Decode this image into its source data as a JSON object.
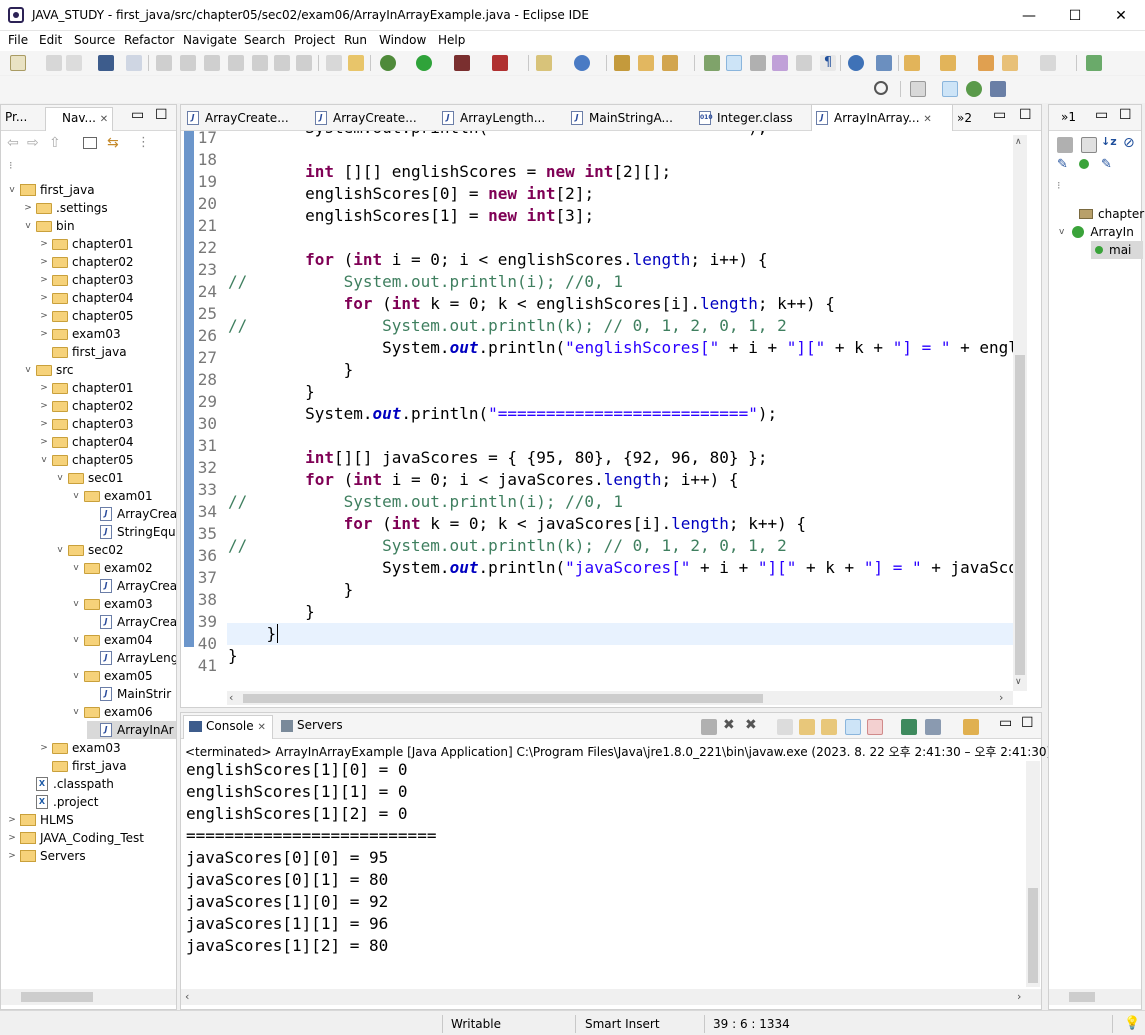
{
  "window": {
    "title": "JAVA_STUDY - first_java/src/chapter05/sec02/exam06/ArrayInArrayExample.java - Eclipse IDE",
    "minimize_glyph": "—",
    "maximize_glyph": "☐",
    "close_glyph": "✕"
  },
  "menu": [
    "File",
    "Edit",
    "Source",
    "Refactor",
    "Navigate",
    "Search",
    "Project",
    "Run",
    "Window",
    "Help"
  ],
  "left_panel": {
    "tabs": [
      "Pr...",
      "Nav..."
    ],
    "close_glyph": "✕",
    "tree": [
      {
        "depth": 0,
        "tw": "v",
        "kind": "proj",
        "label": "first_java"
      },
      {
        "depth": 1,
        "tw": ">",
        "kind": "folder",
        "label": ".settings"
      },
      {
        "depth": 1,
        "tw": "v",
        "kind": "folder",
        "label": "bin"
      },
      {
        "depth": 2,
        "tw": ">",
        "kind": "folder",
        "label": "chapter01"
      },
      {
        "depth": 2,
        "tw": ">",
        "kind": "folder",
        "label": "chapter02"
      },
      {
        "depth": 2,
        "tw": ">",
        "kind": "folder",
        "label": "chapter03"
      },
      {
        "depth": 2,
        "tw": ">",
        "kind": "folder",
        "label": "chapter04"
      },
      {
        "depth": 2,
        "tw": ">",
        "kind": "folder",
        "label": "chapter05"
      },
      {
        "depth": 2,
        "tw": ">",
        "kind": "folder",
        "label": "exam03"
      },
      {
        "depth": 2,
        "tw": "",
        "kind": "folder",
        "label": "first_java"
      },
      {
        "depth": 1,
        "tw": "v",
        "kind": "folder",
        "label": "src"
      },
      {
        "depth": 2,
        "tw": ">",
        "kind": "folder",
        "label": "chapter01"
      },
      {
        "depth": 2,
        "tw": ">",
        "kind": "folder",
        "label": "chapter02"
      },
      {
        "depth": 2,
        "tw": ">",
        "kind": "folder",
        "label": "chapter03"
      },
      {
        "depth": 2,
        "tw": ">",
        "kind": "folder",
        "label": "chapter04"
      },
      {
        "depth": 2,
        "tw": "v",
        "kind": "folder",
        "label": "chapter05"
      },
      {
        "depth": 3,
        "tw": "v",
        "kind": "folder",
        "label": "sec01"
      },
      {
        "depth": 4,
        "tw": "v",
        "kind": "folder",
        "label": "exam01"
      },
      {
        "depth": 5,
        "tw": "",
        "kind": "java",
        "label": "ArrayCrea"
      },
      {
        "depth": 5,
        "tw": "",
        "kind": "java",
        "label": "StringEqu"
      },
      {
        "depth": 3,
        "tw": "v",
        "kind": "folder",
        "label": "sec02"
      },
      {
        "depth": 4,
        "tw": "v",
        "kind": "folder",
        "label": "exam02"
      },
      {
        "depth": 5,
        "tw": "",
        "kind": "java",
        "label": "ArrayCrea"
      },
      {
        "depth": 4,
        "tw": "v",
        "kind": "folder",
        "label": "exam03"
      },
      {
        "depth": 5,
        "tw": "",
        "kind": "java",
        "label": "ArrayCrea"
      },
      {
        "depth": 4,
        "tw": "v",
        "kind": "folder",
        "label": "exam04"
      },
      {
        "depth": 5,
        "tw": "",
        "kind": "java",
        "label": "ArrayLeng"
      },
      {
        "depth": 4,
        "tw": "v",
        "kind": "folder",
        "label": "exam05"
      },
      {
        "depth": 5,
        "tw": "",
        "kind": "java",
        "label": "MainStrir"
      },
      {
        "depth": 4,
        "tw": "v",
        "kind": "folder",
        "label": "exam06"
      },
      {
        "depth": 5,
        "tw": "",
        "kind": "java",
        "label": "ArrayInAr",
        "selected": true
      },
      {
        "depth": 2,
        "tw": ">",
        "kind": "folder",
        "label": "exam03"
      },
      {
        "depth": 2,
        "tw": "",
        "kind": "folder",
        "label": "first_java"
      },
      {
        "depth": 1,
        "tw": "",
        "kind": "xml",
        "label": ".classpath"
      },
      {
        "depth": 1,
        "tw": "",
        "kind": "xml",
        "label": ".project"
      },
      {
        "depth": 0,
        "tw": ">",
        "kind": "proj",
        "label": "HLMS"
      },
      {
        "depth": 0,
        "tw": ">",
        "kind": "proj",
        "label": "JAVA_Coding_Test"
      },
      {
        "depth": 0,
        "tw": ">",
        "kind": "proj",
        "label": "Servers"
      }
    ]
  },
  "editor": {
    "tabs": [
      "ArrayCreate...",
      "ArrayCreate...",
      "ArrayLength...",
      "MainStringA...",
      "Integer.class",
      "ArrayInArray..."
    ],
    "overflow_label": "»2",
    "line_numbers": [
      "17",
      "18",
      "19",
      "20",
      "21",
      "22",
      "23",
      "24",
      "25",
      "26",
      "27",
      "28",
      "29",
      "30",
      "31",
      "32",
      "33",
      "34",
      "35",
      "36",
      "37",
      "38",
      "39",
      "40",
      "41"
    ]
  },
  "console": {
    "tabs": [
      "Console",
      "Servers"
    ],
    "terminated": "<terminated> ArrayInArrayExample [Java Application] C:\\Program Files\\Java\\jre1.8.0_221\\bin\\javaw.exe  (2023. 8. 22 오후 2:41:30 – 오후 2:41:30)",
    "lines": [
      "englishScores[1][0] = 0",
      "englishScores[1][1] = 0",
      "englishScores[1][2] = 0",
      "==========================",
      "javaScores[0][0] = 95",
      "javaScores[0][1] = 80",
      "javaScores[1][0] = 92",
      "javaScores[1][1] = 96",
      "javaScores[1][2] = 80"
    ]
  },
  "right_panel": {
    "overflow_label": "»1",
    "items": [
      "chapter",
      "ArrayIn",
      "mai"
    ]
  },
  "status": {
    "writable": "Writable",
    "insert_mode": "Smart Insert",
    "position": "39 : 6 : 1334"
  }
}
